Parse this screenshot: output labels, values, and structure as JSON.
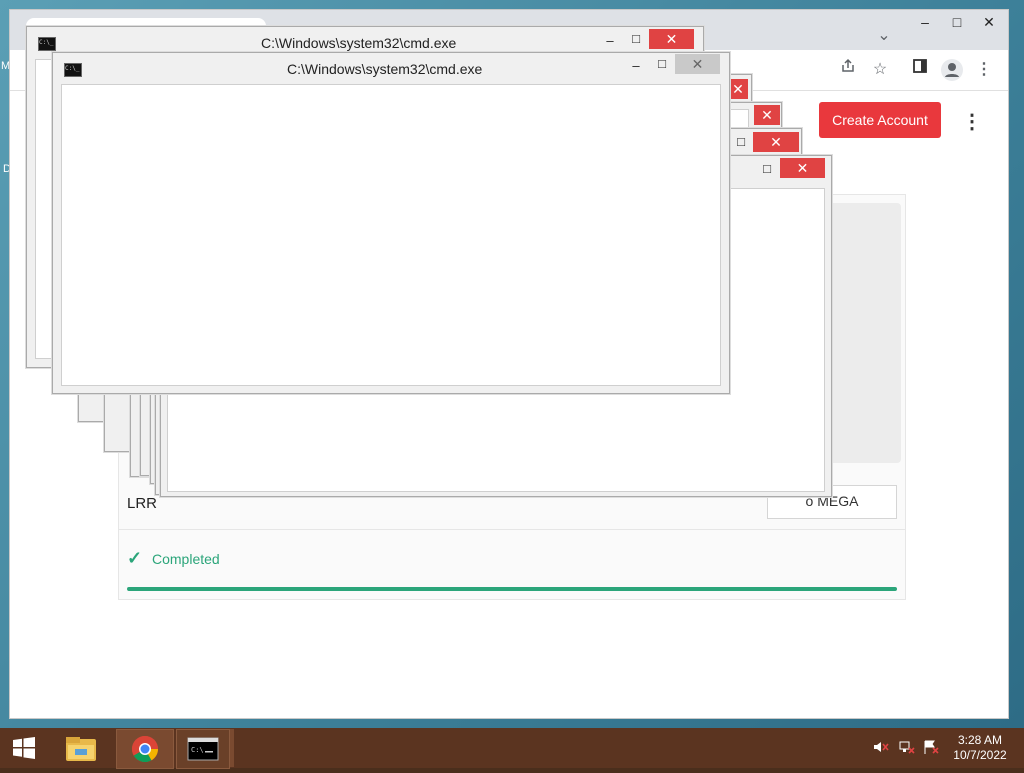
{
  "desktop": {
    "edge_letters": [
      "M",
      "D"
    ]
  },
  "browser": {
    "window_controls": {
      "minimize": "–",
      "maximize": "□",
      "close": "✕"
    },
    "tab_list_icon": "chevron-down",
    "toolbar_icons": [
      "share-icon",
      "bookmark-star-icon",
      "sidepanel-icon",
      "profile-icon",
      "menu-icon"
    ],
    "page": {
      "create_account_label": "Create Account",
      "kebab": "⋮",
      "file": {
        "name_visible": "LRR",
        "save_button_visible": "o MEGA",
        "status": "Completed",
        "progress_percent": 100
      },
      "colors": {
        "accent_red": "#e9383d",
        "success_green": "#2ba57a"
      }
    }
  },
  "cmd": {
    "title": "C:\\Windows\\system32\\cmd.exe",
    "icon_text": "C:\\_",
    "controls": {
      "minimize": "–",
      "maximize": "□",
      "close": "✕"
    }
  },
  "taskbar": {
    "clock": {
      "time": "3:28 AM",
      "date": "10/7/2022"
    },
    "apps": [
      "start-icon",
      "file-explorer-icon",
      "chrome-icon",
      "cmd-icon"
    ],
    "tray": [
      "speaker-muted-icon",
      "network-icon",
      "action-center-flag-icon"
    ]
  }
}
